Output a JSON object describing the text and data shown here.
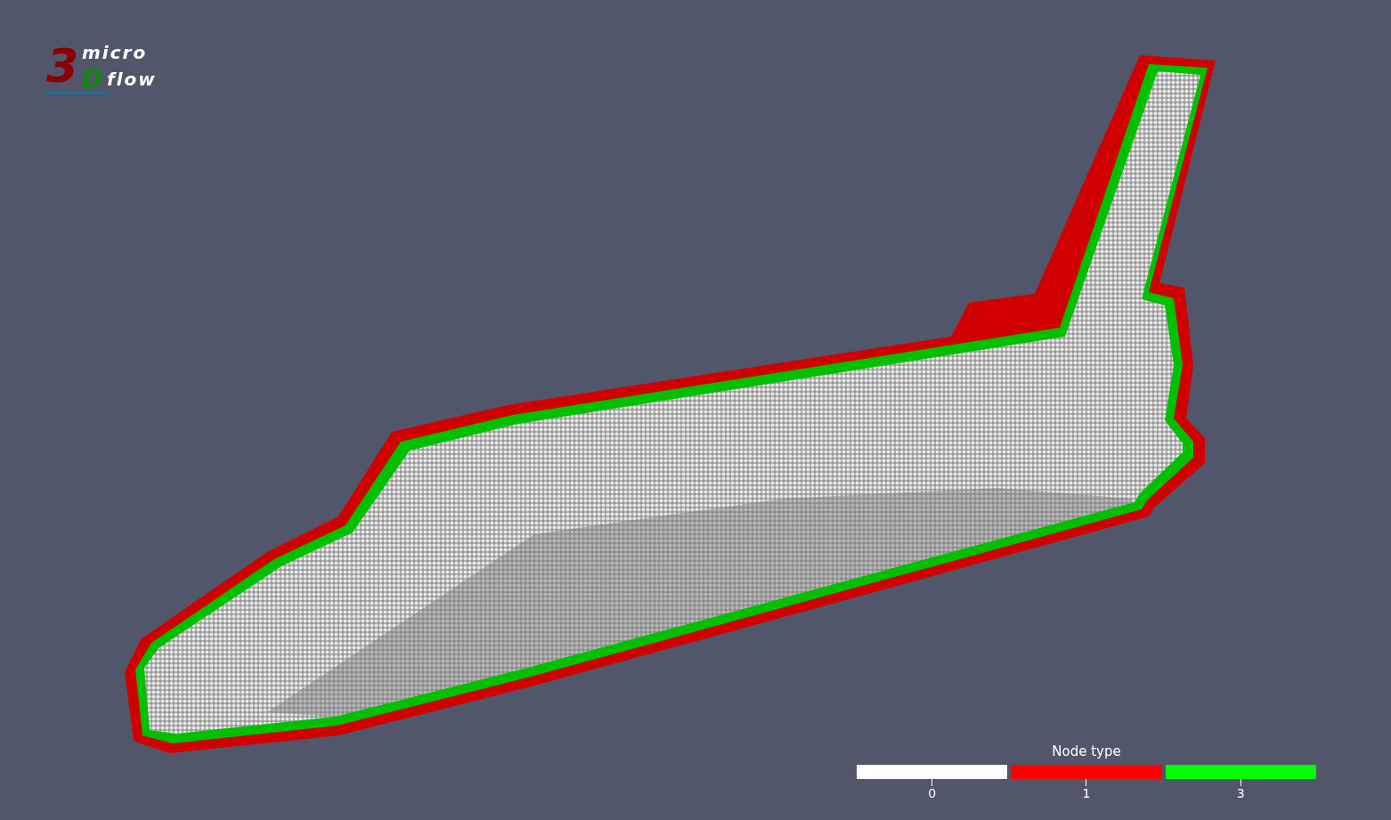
{
  "logo": {
    "digit": "3",
    "letter": "D",
    "word_top": "micro",
    "word_bottom": "flow"
  },
  "legend": {
    "title": "Node type",
    "entries": [
      {
        "label": "0",
        "color": "#ffffff"
      },
      {
        "label": "1",
        "color": "#ff0000"
      },
      {
        "label": "3",
        "color": "#00ff00"
      }
    ]
  }
}
